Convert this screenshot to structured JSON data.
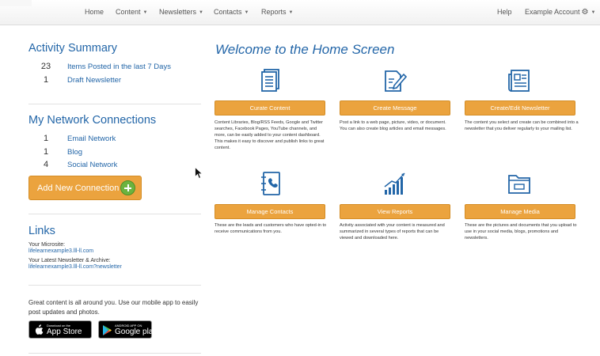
{
  "nav": {
    "home": "Home",
    "content": "Content",
    "newsletters": "Newsletters",
    "contacts": "Contacts",
    "reports": "Reports",
    "help": "Help",
    "account": "Example Account"
  },
  "activity": {
    "title": "Activity Summary",
    "items": [
      {
        "count": "23",
        "label": "Items Posted in the last 7 Days"
      },
      {
        "count": "1",
        "label": "Draft Newsletter"
      }
    ]
  },
  "network": {
    "title": "My Network Connections",
    "items": [
      {
        "count": "1",
        "label": "Email Network"
      },
      {
        "count": "1",
        "label": "Blog"
      },
      {
        "count": "4",
        "label": "Social Network"
      }
    ],
    "add_button": "Add New Connection"
  },
  "links": {
    "title": "Links",
    "microsite_label": "Your Microsite:",
    "microsite_url": "lifelearnexample3.lll-ll.com",
    "newsletter_label": "Your Latest Newsletter & Archive:",
    "newsletter_url": "lifelearnexample3.lll-ll.com?newsletter"
  },
  "promo": {
    "text": "Great content is all around you. Use our mobile app to easily post updates and photos.",
    "appstore_small": "Download on the",
    "appstore_big": "App Store",
    "googleplay_small": "ANDROID APP ON",
    "googleplay_big": "Google play"
  },
  "main": {
    "welcome": "Welcome to the Home Screen",
    "tiles": [
      {
        "button": "Curate Content",
        "icon": "document-stack-icon",
        "desc": "Content Libraries, Blog/RSS Feeds, Google and Twitter searches, Facebook Pages, YouTube channels, and more, can be easily added to your content dashboard. This makes it easy to discover and publish links to great content."
      },
      {
        "button": "Create Message",
        "icon": "edit-document-icon",
        "desc": "Post a link to a web page, picture, video, or document. You can also create blog articles and email messages."
      },
      {
        "button": "Create/Edit Newsletter",
        "icon": "newspaper-icon",
        "desc": "The content you select and create can be combined into a newsletter that you deliver regularly to your mailing list."
      },
      {
        "button": "Manage Contacts",
        "icon": "address-book-icon",
        "desc": "These are the leads and customers who have opted-in to receive communications from you."
      },
      {
        "button": "View Reports",
        "icon": "bar-chart-icon",
        "desc": "Activity associated with your content is measured and summarized in several types of reports that can be viewed and downloaded here."
      },
      {
        "button": "Manage Media",
        "icon": "folder-icon",
        "desc": "These are the pictures and documents that you upload to use in your social media, blogs, promotions and newsletters."
      }
    ]
  },
  "colors": {
    "accent_blue": "#2366a8",
    "button_orange": "#eba33e",
    "plus_green": "#6cb33f"
  }
}
